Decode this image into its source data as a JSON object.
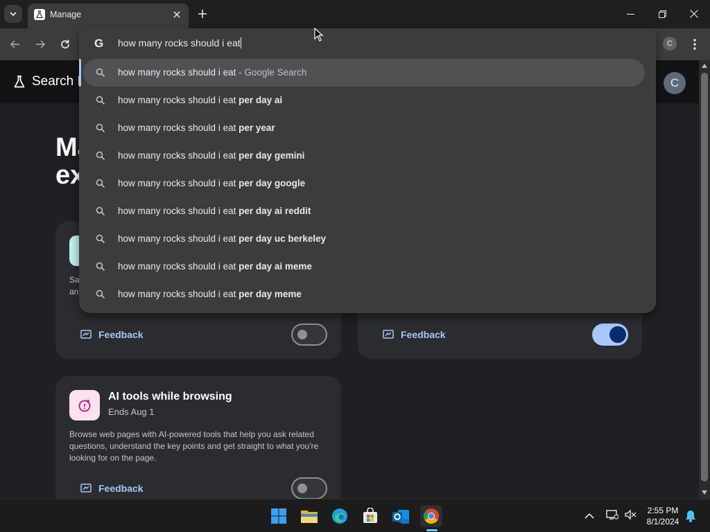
{
  "browser": {
    "tab": {
      "title": "Manage"
    },
    "address_bar": {
      "value": "how many rocks should i eat"
    },
    "profile_initial": "C"
  },
  "page": {
    "brand": "Search Labs",
    "avatar_initial": "C",
    "hero_title_line1": "Ma",
    "hero_title_line2": "ex",
    "card1": {
      "desc_line1": "Sa",
      "desc_line2": "an",
      "feedback_label": "Feedback",
      "toggle_on": false
    },
    "card2": {
      "feedback_label": "Feedback",
      "toggle_on": true
    },
    "card3": {
      "title": "AI tools while browsing",
      "subtitle": "Ends Aug 1",
      "description": "Browse web pages with AI-powered tools that help you ask related questions, understand the key points and get straight to what you're looking for on the page.",
      "feedback_label": "Feedback",
      "toggle_on": false
    }
  },
  "omnibox": {
    "suggestions": [
      {
        "prefix": "how many rocks should i eat",
        "bold": "",
        "suffix": " - Google Search",
        "selected": true
      },
      {
        "prefix": "how many rocks should i eat ",
        "bold": "per day ai",
        "suffix": ""
      },
      {
        "prefix": "how many rocks should i eat ",
        "bold": "per year",
        "suffix": ""
      },
      {
        "prefix": "how many rocks should i eat ",
        "bold": "per day gemini",
        "suffix": ""
      },
      {
        "prefix": "how many rocks should i eat ",
        "bold": "per day google",
        "suffix": ""
      },
      {
        "prefix": "how many rocks should i eat ",
        "bold": "per day ai reddit",
        "suffix": ""
      },
      {
        "prefix": "how many rocks should i eat ",
        "bold": "per day uc berkeley",
        "suffix": ""
      },
      {
        "prefix": "how many rocks should i eat ",
        "bold": "per day ai meme",
        "suffix": ""
      },
      {
        "prefix": "how many rocks should i eat ",
        "bold": "per day meme",
        "suffix": ""
      }
    ]
  },
  "taskbar": {
    "apps": [
      "windows-start-icon",
      "file-explorer-icon",
      "edge-icon",
      "microsoft-store-icon",
      "outlook-icon",
      "chrome-icon"
    ],
    "time": "2:55 PM",
    "date": "8/1/2024"
  },
  "colors": {
    "accent": "#a8c7fa",
    "toggle_knob_on": "#062e6f",
    "page_bg": "#1f2023",
    "card_bg": "#2b2c30"
  }
}
